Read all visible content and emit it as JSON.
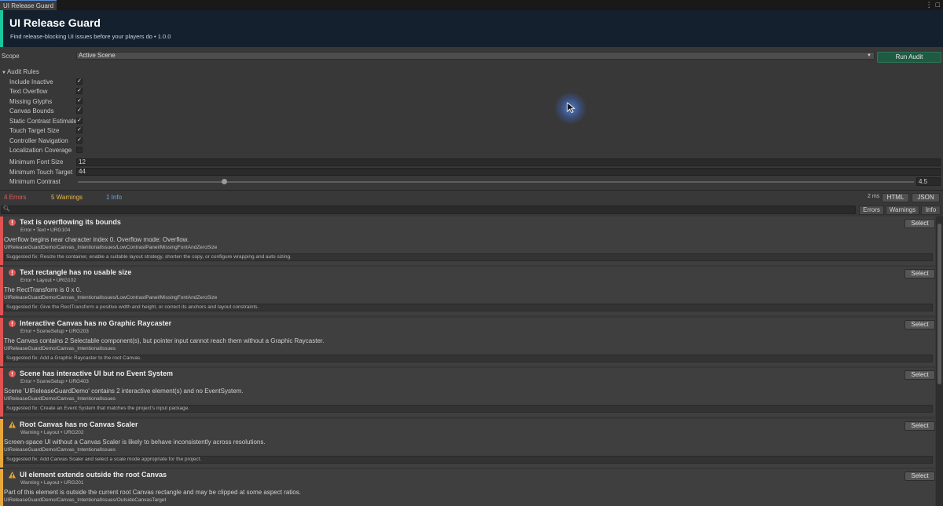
{
  "window": {
    "tab_title": "UI Release Guard"
  },
  "header": {
    "title": "UI Release Guard",
    "subtitle": "Find release-blocking UI issues before your players do  •  1.0.0",
    "accent_color": "#19c79e"
  },
  "scope": {
    "label": "Scope",
    "value": "Active Scene",
    "run_label": "Run Audit"
  },
  "rules": {
    "foldout_label": "Audit Rules",
    "items": [
      {
        "label": "Include Inactive",
        "checked": true
      },
      {
        "label": "Text Overflow",
        "checked": true
      },
      {
        "label": "Missing Glyphs",
        "checked": true
      },
      {
        "label": "Canvas Bounds",
        "checked": true
      },
      {
        "label": "Static Contrast Estimate",
        "checked": true
      },
      {
        "label": "Touch Target Size",
        "checked": true
      },
      {
        "label": "Controller Navigation",
        "checked": true
      },
      {
        "label": "Localization Coverage",
        "checked": false
      }
    ],
    "min_font_label": "Minimum Font Size",
    "min_font_value": "12",
    "min_touch_label": "Minimum Touch Target",
    "min_touch_value": "44",
    "min_contrast_label": "Minimum Contrast",
    "min_contrast_value": "4.5",
    "min_contrast_fraction": 0.174
  },
  "summary": {
    "errors": "4 Errors",
    "warnings": "5 Warnings",
    "info": "1 Info",
    "duration": "2 ms",
    "html_label": "HTML",
    "json_label": "JSON",
    "colors": {
      "error": "#ee5a5a",
      "warning": "#e9b948",
      "info": "#6fa2ee"
    }
  },
  "filters": {
    "errors_label": "Errors",
    "warnings_label": "Warnings",
    "info_label": "Info"
  },
  "issues": [
    {
      "severity": "error",
      "title": "Text is overflowing its bounds",
      "meta": "Error  •  Text  •  URG104",
      "description": "Overflow begins near character index 0. Overflow mode: Overflow.",
      "path": "UIReleaseGuardDemo/Canvas_IntentionalIssues/LowContrastPanel/MissingFontAndZeroSize",
      "fix": "Suggested fix: Resize the container, enable a suitable layout strategy, shorten the copy, or configure wrapping and auto sizing.",
      "select_label": "Select"
    },
    {
      "severity": "error",
      "title": "Text rectangle has no usable size",
      "meta": "Error  •  Layout  •  URG102",
      "description": "The RectTransform is 0 x 0.",
      "path": "UIReleaseGuardDemo/Canvas_IntentionalIssues/LowContrastPanel/MissingFontAndZeroSize",
      "fix": "Suggested fix: Give the RectTransform a positive width and height, or correct its anchors and layout constraints.",
      "select_label": "Select"
    },
    {
      "severity": "error",
      "title": "Interactive Canvas has no Graphic Raycaster",
      "meta": "Error  •  SceneSetup  •  URG203",
      "description": "The Canvas contains 2 Selectable component(s), but pointer input cannot reach them without a Graphic Raycaster.",
      "path": "UIReleaseGuardDemo/Canvas_IntentionalIssues",
      "fix": "Suggested fix: Add a Graphic Raycaster to the root Canvas.",
      "select_label": "Select"
    },
    {
      "severity": "error",
      "title": "Scene has interactive UI but no Event System",
      "meta": "Error  •  SceneSetup  •  URG403",
      "description": "Scene 'UIReleaseGuardDemo' contains 2 interactive element(s) and no EventSystem.",
      "path": "UIReleaseGuardDemo/Canvas_IntentionalIssues",
      "fix": "Suggested fix: Create an Event System that matches the project's input package.",
      "select_label": "Select"
    },
    {
      "severity": "warning",
      "title": "Root Canvas has no Canvas Scaler",
      "meta": "Warning  •  Layout  •  URG202",
      "description": "Screen-space UI without a Canvas Scaler is likely to behave inconsistently across resolutions.",
      "path": "UIReleaseGuardDemo/Canvas_IntentionalIssues",
      "fix": "Suggested fix: Add Canvas Scaler and select a scale mode appropriate for the project.",
      "select_label": "Select"
    },
    {
      "severity": "warning",
      "title": "UI element extends outside the root Canvas",
      "meta": "Warning  •  Layout  •  URG201",
      "description": "Part of this element is outside the current root Canvas rectangle and may be clipped at some aspect ratios.",
      "path": "UIReleaseGuardDemo/Canvas_IntentionalIssues/OutsideCanvasTarget",
      "fix": "",
      "select_label": "Select"
    }
  ]
}
